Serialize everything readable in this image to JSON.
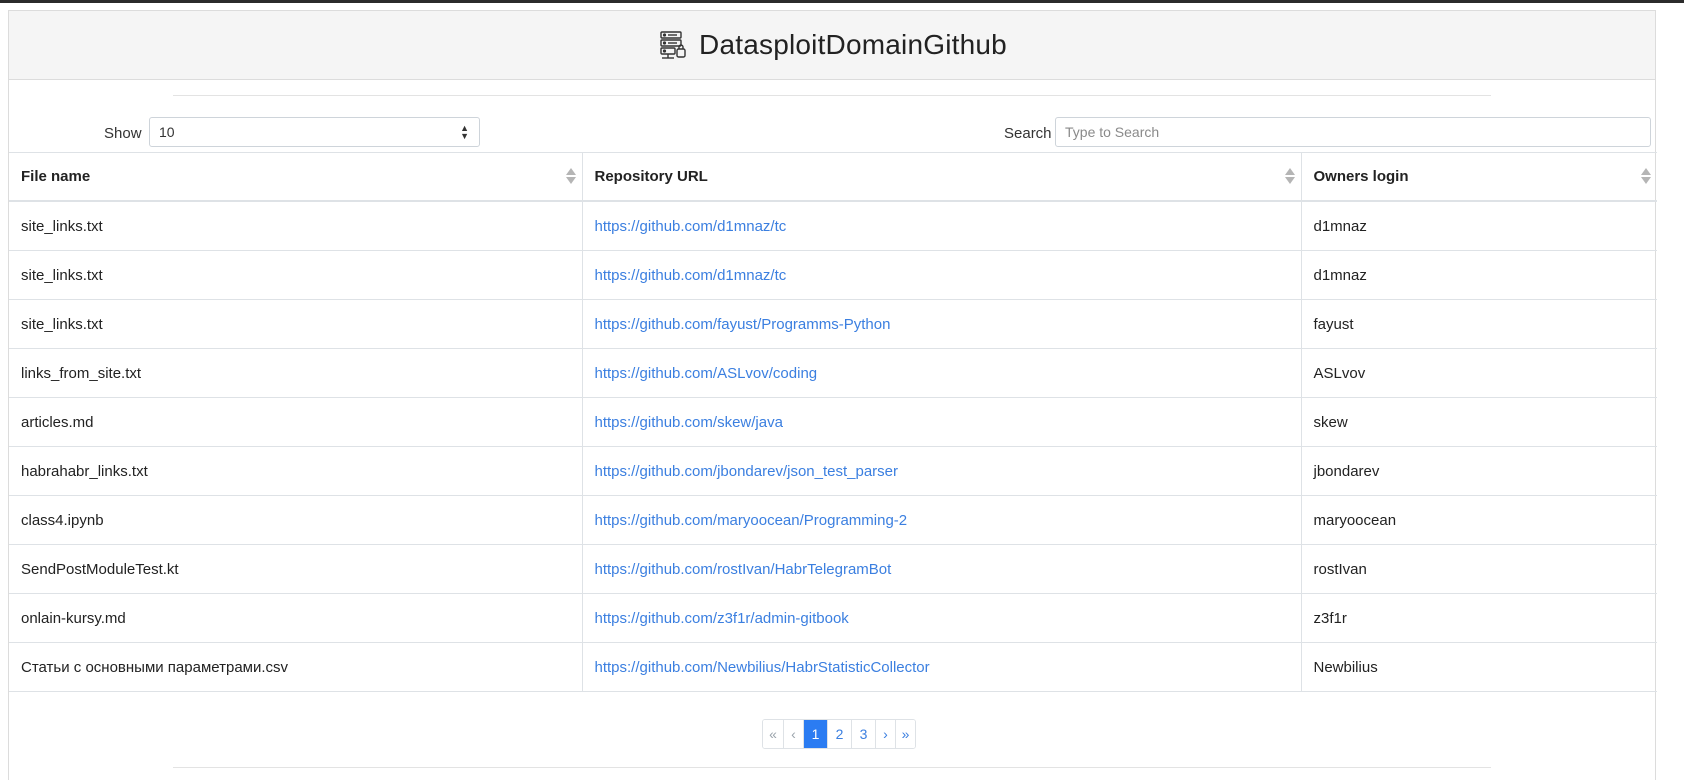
{
  "header": {
    "title": "DatasploitDomainGithub",
    "icon": "server-stack-icon"
  },
  "controls": {
    "show_label": "Show",
    "show_value": "10",
    "search_label": "Search",
    "search_placeholder": "Type to Search",
    "search_value": ""
  },
  "table": {
    "columns": [
      "File name",
      "Repository URL",
      "Owners login"
    ],
    "rows": [
      {
        "file": "site_links.txt",
        "url": "https://github.com/d1mnaz/tc",
        "owner": "d1mnaz"
      },
      {
        "file": "site_links.txt",
        "url": "https://github.com/d1mnaz/tc",
        "owner": "d1mnaz"
      },
      {
        "file": "site_links.txt",
        "url": "https://github.com/fayust/Programms-Python",
        "owner": "fayust"
      },
      {
        "file": "links_from_site.txt",
        "url": "https://github.com/ASLvov/coding",
        "owner": "ASLvov"
      },
      {
        "file": "articles.md",
        "url": "https://github.com/skew/java",
        "owner": "skew"
      },
      {
        "file": "habrahabr_links.txt",
        "url": "https://github.com/jbondarev/json_test_parser",
        "owner": "jbondarev"
      },
      {
        "file": "class4.ipynb",
        "url": "https://github.com/maryoocean/Programming-2",
        "owner": "maryoocean"
      },
      {
        "file": "SendPostModuleTest.kt",
        "url": "https://github.com/rostIvan/HabrTelegramBot",
        "owner": "rostIvan"
      },
      {
        "file": "onlain-kursy.md",
        "url": "https://github.com/z3f1r/admin-gitbook",
        "owner": "z3f1r"
      },
      {
        "file": "Статьи с основными параметрами.csv",
        "url": "https://github.com/Newbilius/HabrStatisticCollector",
        "owner": "Newbilius"
      }
    ]
  },
  "pagination": {
    "first": "«",
    "prev": "‹",
    "pages": [
      "1",
      "2",
      "3"
    ],
    "current": "1",
    "next": "›",
    "last": "»"
  },
  "colors": {
    "link": "#3b7fe0",
    "active_page": "#2b7cf2",
    "header_bg": "#f5f5f5"
  }
}
